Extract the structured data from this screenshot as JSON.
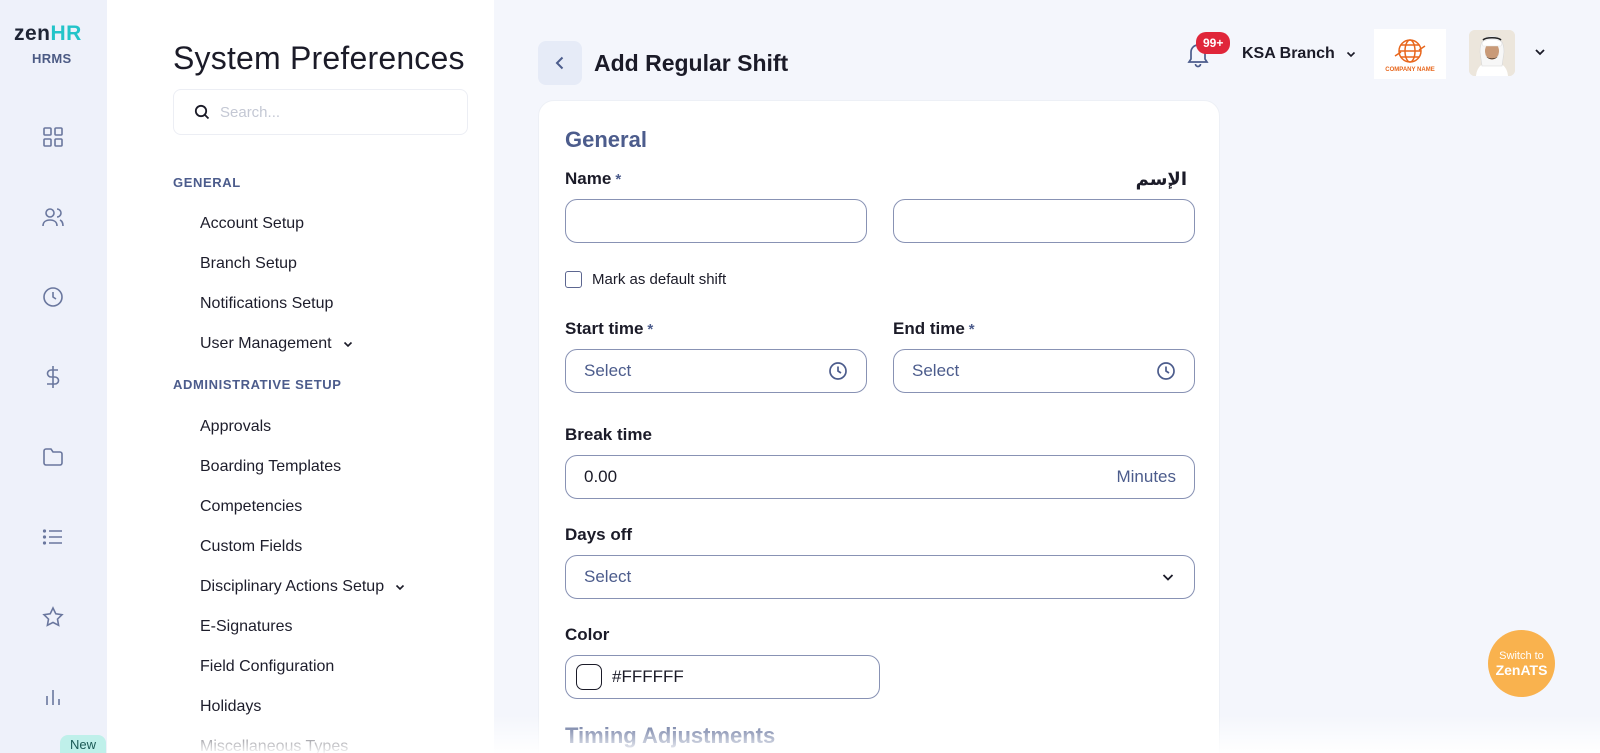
{
  "app": {
    "logo_main": "zen",
    "logo_accent": "HR",
    "logo_sub": "HRMS",
    "new_badge": "New"
  },
  "rail_icons": [
    "dashboard-icon",
    "people-icon",
    "clock-icon",
    "dollar-icon",
    "folder-icon",
    "list-icon",
    "star-icon",
    "bar-chart-icon"
  ],
  "sidebar": {
    "title": "System Preferences",
    "search_placeholder": "Search...",
    "sections": [
      {
        "title": "GENERAL",
        "items": [
          {
            "label": "Account Setup"
          },
          {
            "label": "Branch Setup"
          },
          {
            "label": "Notifications Setup"
          },
          {
            "label": "User Management",
            "expandable": true
          }
        ]
      },
      {
        "title": "ADMINISTRATIVE SETUP",
        "items": [
          {
            "label": "Approvals"
          },
          {
            "label": "Boarding Templates"
          },
          {
            "label": "Competencies"
          },
          {
            "label": "Custom Fields"
          },
          {
            "label": "Disciplinary Actions Setup",
            "expandable": true
          },
          {
            "label": "E-Signatures"
          },
          {
            "label": "Field Configuration"
          },
          {
            "label": "Holidays"
          },
          {
            "label": "Miscellaneous Types"
          }
        ]
      }
    ]
  },
  "header": {
    "page_title": "Add Regular Shift",
    "notification_count": "99+",
    "branch": "KSA Branch",
    "company_logo_text": "COMPANY NAME"
  },
  "form": {
    "section_general": "General",
    "name_label": "Name",
    "name_required": "*",
    "name_ar_label": "الإسم",
    "name_value": "",
    "name_ar_value": "",
    "default_shift_label": "Mark as default shift",
    "default_shift_checked": false,
    "start_time_label": "Start time",
    "start_time_placeholder": "Select",
    "end_time_label": "End time",
    "end_time_placeholder": "Select",
    "break_time_label": "Break time",
    "break_time_value": "0.00",
    "break_time_unit": "Minutes",
    "days_off_label": "Days off",
    "days_off_placeholder": "Select",
    "color_label": "Color",
    "color_value": "#FFFFFF",
    "next_section": "Timing Adjustments"
  },
  "switch_button": {
    "line1": "Switch to",
    "line2": "ZenATS"
  },
  "colors": {
    "accent": "#4c5c8c",
    "logo_accent": "#23c4c9",
    "badge_red": "#e0263a",
    "switch_orange": "#f9b24e"
  }
}
